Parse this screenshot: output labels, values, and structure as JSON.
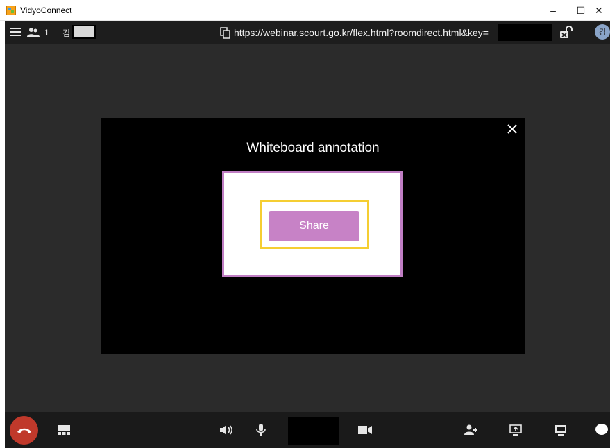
{
  "window": {
    "title": "VidyoConnect",
    "minimize": "–",
    "maximize": "☐",
    "close": "✕"
  },
  "topbar": {
    "participant_count": "1",
    "user_initial": "김",
    "url": "https://webinar.scourt.go.kr/flex.html?roomdirect.html&key=",
    "avatar_initial": "김"
  },
  "modal": {
    "title": "Whiteboard annotation",
    "share_label": "Share"
  },
  "colors": {
    "app_bg": "#2b2b2b",
    "topbar_bg": "#1d1d1d",
    "modal_bg": "#000000",
    "share_button": "#c782c6",
    "panel_border": "#c07ec4",
    "highlight": "#f5ce32",
    "hangup": "#c0392b"
  },
  "icons": {
    "menu": "hamburger-icon",
    "participants": "participants-icon",
    "copy": "copy-icon",
    "lock": "unlock-icon",
    "close": "close-icon",
    "hangup": "phone-hangup-icon",
    "layout": "layout-icon",
    "speaker": "speaker-icon",
    "mic": "microphone-icon",
    "camera": "camera-icon",
    "invite": "add-user-icon",
    "share_screen": "share-screen-icon",
    "monitor": "monitor-icon",
    "chat": "chat-icon"
  }
}
